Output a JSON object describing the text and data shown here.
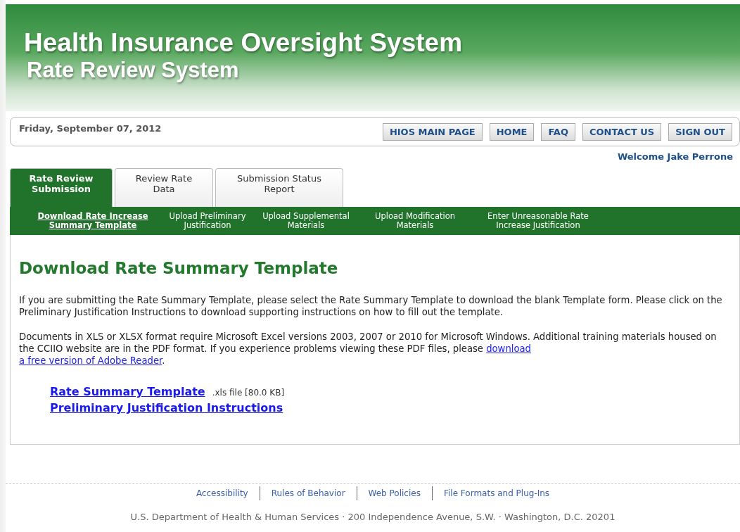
{
  "header": {
    "title": "Health Insurance Oversight System",
    "subtitle": "Rate Review System"
  },
  "top_bar": {
    "date": "Friday, September 07, 2012",
    "buttons": [
      "HIOS MAIN PAGE",
      "HOME",
      "FAQ",
      "CONTACT US",
      "SIGN OUT"
    ]
  },
  "welcome": "Welcome Jake Perrone",
  "tabs": [
    {
      "label": "Rate Review Submission",
      "selected": true
    },
    {
      "label": "Review Rate Data",
      "selected": false
    },
    {
      "label": "Submission Status Report",
      "selected": false
    }
  ],
  "subnav": [
    {
      "label": "Download Rate Increase Summary Template",
      "selected": true
    },
    {
      "label": "Upload Preliminary Justification",
      "selected": false
    },
    {
      "label": "Upload Supplemental Materials",
      "selected": false
    },
    {
      "label": "Upload Modification Materials",
      "selected": false
    },
    {
      "label": "Enter Unreasonable Rate Increase Justification",
      "selected": false
    }
  ],
  "content": {
    "heading": "Download Rate Summary Template",
    "paragraph_1": "If you are submitting the Rate Summary Template, please select the Rate Summary Template to download the blank Template form. Please click on the Preliminary Justification Instructions to download supporting instructions on how to fill out the template.",
    "paragraph_2": {
      "text": "Documents in XLS or XLSX format require Microsoft Excel versions 2003, 2007 or 2010 for Microsoft Windows. Additional training materials housed on the CCIIO website are in the PDF format. If you experience problems viewing these PDF files, please ",
      "link_lines": [
        "download",
        "a free version of Adobe Reader"
      ],
      "after": "."
    },
    "downloads": [
      {
        "label": "Rate Summary Template",
        "note": ".xls file [80.0 KB]"
      },
      {
        "label": "Preliminary Justification Instructions"
      }
    ]
  },
  "footer": {
    "links": [
      "Accessibility",
      "Rules of Behavior",
      "Web Policies",
      "File Formats and Plug-Ins"
    ],
    "address": "U.S. Department of Health & Human Services · 200 Independence Avenue, S.W. · Washington, D.C. 20201"
  }
}
